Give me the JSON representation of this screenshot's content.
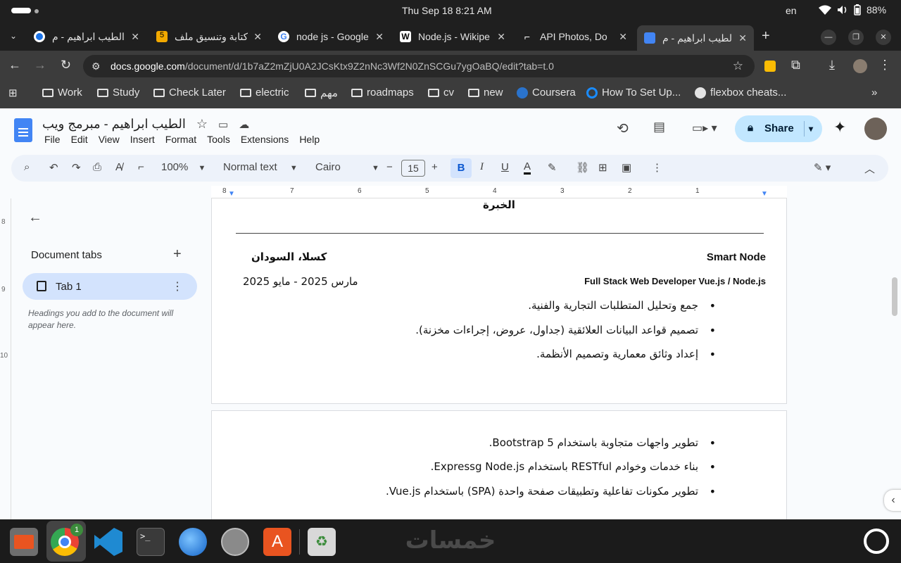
{
  "system": {
    "clock": "Thu Sep 18   8:21 AM",
    "lang": "en",
    "battery": "88%"
  },
  "tabs": [
    {
      "title": "الطيب ابراهيم - م",
      "favicon": "chrome-icon"
    },
    {
      "title": "كتابة وتنسيق ملف",
      "favicon": "number-5-icon"
    },
    {
      "title": "node js - Google",
      "favicon": "google-icon"
    },
    {
      "title": "Node.js - Wikipe",
      "favicon": "wikipedia-icon"
    },
    {
      "title": "API Photos, Do",
      "favicon": "postman-icon"
    },
    {
      "title": "الطيب ابراهيم - م",
      "favicon": "docs-icon"
    }
  ],
  "address": {
    "host": "docs.google.com",
    "path": "/document/d/1b7aZ2mZjU0A2JCsKtx9Z2nNc3Wf2N0ZnSCGu7ygOaBQ/edit?tab=t.0"
  },
  "bookmarks": [
    "Work",
    "Study",
    "Check Later",
    "electric",
    "مهم",
    "roadmaps",
    "cv",
    "new",
    "Coursera",
    "How To Set Up...",
    "flexbox cheats..."
  ],
  "doc": {
    "title": "الطيب ابراهيم - مبرمج ويب",
    "menu": [
      "File",
      "Edit",
      "View",
      "Insert",
      "Format",
      "Tools",
      "Extensions",
      "Help"
    ],
    "share": "Share",
    "toolbar": {
      "zoom": "100%",
      "style": "Normal text",
      "font": "Cairo",
      "size": "15"
    },
    "sidebar": {
      "heading": "Document tabs",
      "tab": "Tab 1",
      "hint": "Headings you add to the document will appear here."
    },
    "ruler_h": [
      "8",
      "7",
      "6",
      "5",
      "4",
      "3",
      "2",
      "1"
    ],
    "ruler_v": [
      "8",
      "9",
      "10"
    ],
    "content": {
      "section": "الخبرة",
      "company": "Smart Node",
      "location": "كسلا، السودان",
      "role": "Full Stack Web Developer Vue.js / Node.js",
      "dates": "مارس 2025 - مايو 2025",
      "bullets1": [
        "جمع وتحليل المتطلبات التجارية والفنية.",
        "تصميم قواعد البيانات العلائقية (جداول، عروض، إجراءات مخزنة).",
        "إعداد وثائق معمارية وتصميم الأنظمة."
      ],
      "bullets2": [
        "تطوير واجهات متجاوبة باستخدام Bootstrap 5.",
        "بناء خدمات وخوادم RESTful باستخدام Expressg Node.js.",
        "تطوير مكونات تفاعلية وتطبيقات صفحة واحدة (SPA) باستخدام Vue.js."
      ]
    }
  },
  "taskbar": {
    "watermark": "خمسات",
    "chrome_badge": "1",
    "apps": [
      "files-icon",
      "chrome-icon",
      "vscode-icon",
      "terminal-icon",
      "thunderbird-icon",
      "clock-icon",
      "appcenter-icon",
      "trash-icon",
      "ubuntu-icon"
    ]
  },
  "colors": {
    "accent": "#0b57d0",
    "share_bg": "#c2e7ff",
    "toolbar_bg": "#edf2fa"
  }
}
